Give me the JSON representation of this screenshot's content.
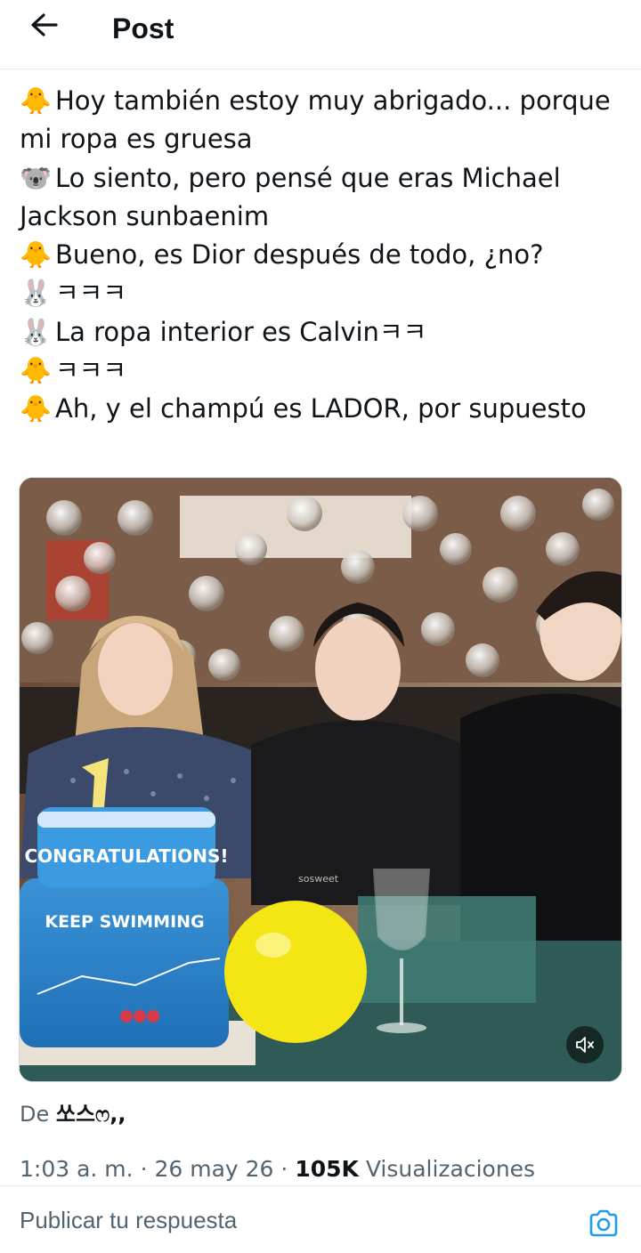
{
  "header": {
    "title": "Post",
    "back_icon": "arrow-left-icon"
  },
  "post": {
    "lines": [
      {
        "emoji": "🐥",
        "text": "Hoy también estoy muy abrigado... porque mi ropa es gruesa"
      },
      {
        "emoji": "🐨",
        "text": "Lo siento, pero pensé que eras Michael Jackson sunbaenim"
      },
      {
        "emoji": "🐥",
        "text": "Bueno, es Dior después de todo, ¿no?"
      },
      {
        "emoji": "🐰",
        "text": "ㅋㅋㅋ"
      },
      {
        "emoji": "🐰",
        "text": "La ropa interior es Calvinㅋㅋ"
      },
      {
        "emoji": "🐥",
        "text": "ㅋㅋㅋ"
      },
      {
        "emoji": "🐥",
        "text": "Ah, y el champú es LADOR, por supuesto"
      }
    ]
  },
  "media": {
    "cake_text_top": "CONGRATULATIONS!",
    "cake_text_mid": "KEEP SWIMMING",
    "watermark": "sosweet",
    "mute_icon": "volume-muted-icon"
  },
  "source": {
    "prefix": "De",
    "author": "쏘스ෆ,,"
  },
  "meta": {
    "time": "1:03 a. m.",
    "separator": "·",
    "date": "26 may 26",
    "views_count": "105K",
    "views_label": "Visualizaciones"
  },
  "reply": {
    "placeholder": "Publicar tu respuesta",
    "camera_icon": "camera-icon"
  },
  "colors": {
    "accent": "#1d9bf0",
    "text": "#0f1419",
    "secondary": "#536471",
    "border": "#e7e9ea"
  }
}
